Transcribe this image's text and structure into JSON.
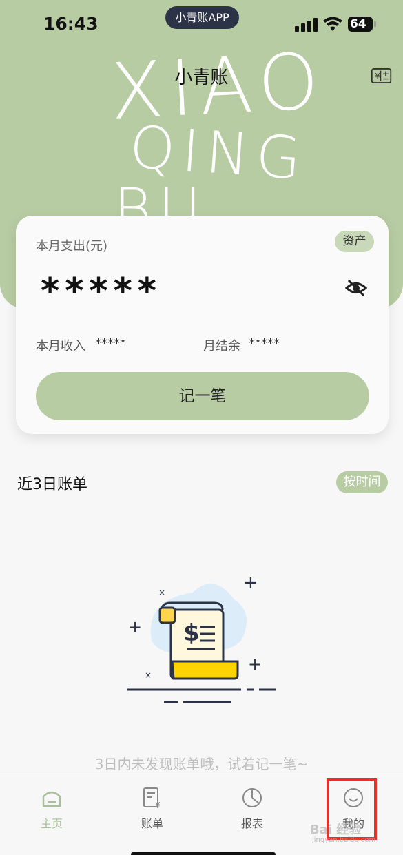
{
  "status_bar": {
    "time": "16:43",
    "app_pill": "小青账APP",
    "battery": "64"
  },
  "header": {
    "title": "小青账",
    "decoration_lines": [
      "XIAO",
      "QING",
      "BU"
    ]
  },
  "summary_card": {
    "expense_label": "本月支出(元)",
    "asset_tag": "资产",
    "amount": "*****",
    "income_label": "本月收入",
    "income_value": "*****",
    "balance_label": "月结余",
    "balance_value": "*****",
    "record_button": "记一笔"
  },
  "recent": {
    "title": "近3日账单",
    "sort_tag": "按时间",
    "empty_message": "3日内未发现账单哦，试着记一笔~"
  },
  "tabbar": {
    "items": [
      {
        "label": "主页",
        "icon": "home-icon",
        "active": true
      },
      {
        "label": "账单",
        "icon": "bill-icon",
        "active": false
      },
      {
        "label": "报表",
        "icon": "pie-chart-icon",
        "active": false
      },
      {
        "label": "我的",
        "icon": "smile-icon",
        "active": false
      }
    ]
  },
  "watermark": {
    "text": "Bai 经验",
    "sub": "jingyan.baidu.com"
  },
  "colors": {
    "accent": "#b8cca3",
    "highlight": "#e0332e",
    "background": "#f7f7f7"
  }
}
